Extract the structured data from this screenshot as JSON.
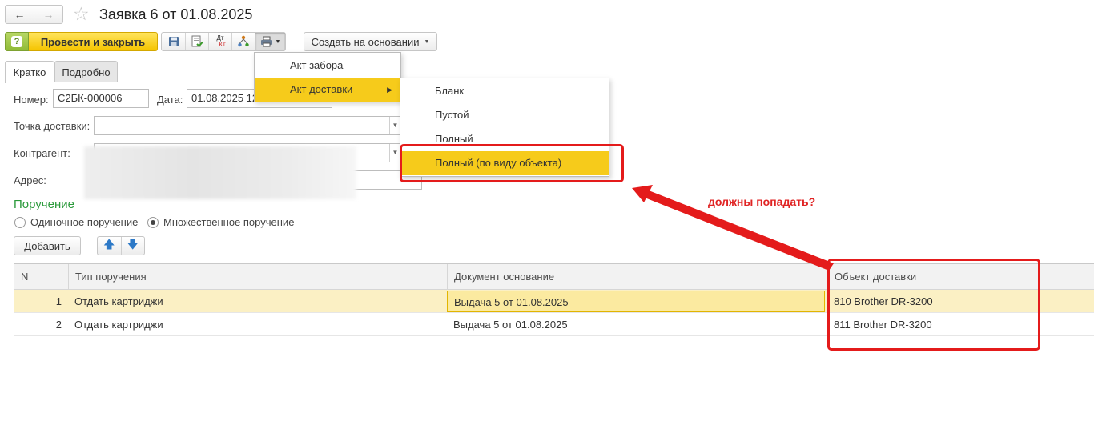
{
  "window": {
    "title": "Заявка 6 от 01.08.2025",
    "back_icon": "arrow-left-icon",
    "forward_icon": "arrow-right-icon",
    "favorite_icon": "star-icon"
  },
  "toolbar": {
    "help_label": "?",
    "post_and_close_label": "Провести и закрыть",
    "create_based_on_label": "Создать на основании",
    "icons": [
      "save-icon",
      "post-icon",
      "dt-kt-icon",
      "structure-icon",
      "print-icon"
    ],
    "dtkt_top": "Дт",
    "dtkt_bottom": "Кт"
  },
  "tabs": [
    {
      "label": "Кратко",
      "active": true
    },
    {
      "label": "Подробно",
      "active": false
    }
  ],
  "form": {
    "number_label": "Номер:",
    "number_value": "С2БК-000006",
    "date_label": "Дата:",
    "date_value": "01.08.2025 12",
    "delivery_point_label": "Точка доставки:",
    "delivery_point_value": "",
    "counterparty_label": "Контрагент:",
    "counterparty_value": "",
    "address_label": "Адрес:",
    "address_value": ""
  },
  "order_section": {
    "title": "Поручение",
    "radio_single": "Одиночное поручение",
    "radio_multiple": "Множественное поручение",
    "selected": "multiple",
    "add_button": "Добавить"
  },
  "table": {
    "columns": [
      "N",
      "Тип поручения",
      "Документ основание",
      "Объект доставки"
    ],
    "rows": [
      {
        "n": "1",
        "type": "Отдать картриджи",
        "doc": "Выдача 5 от 01.08.2025",
        "object": "810 Brother DR-3200",
        "selected": true
      },
      {
        "n": "2",
        "type": "Отдать картриджи",
        "doc": "Выдача 5 от 01.08.2025",
        "object": "811 Brother DR-3200",
        "selected": false
      }
    ]
  },
  "print_menu": {
    "items": [
      "Акт забора",
      "Акт доставки"
    ],
    "highlighted": "Акт доставки"
  },
  "print_submenu": {
    "items": [
      "Бланк",
      "Пустой",
      "Полный",
      "Полный (по виду объекта)"
    ],
    "highlighted": "Полный (по виду объекта)"
  },
  "annotation": {
    "text": "должны попадать?",
    "color": "#e41b1b"
  }
}
